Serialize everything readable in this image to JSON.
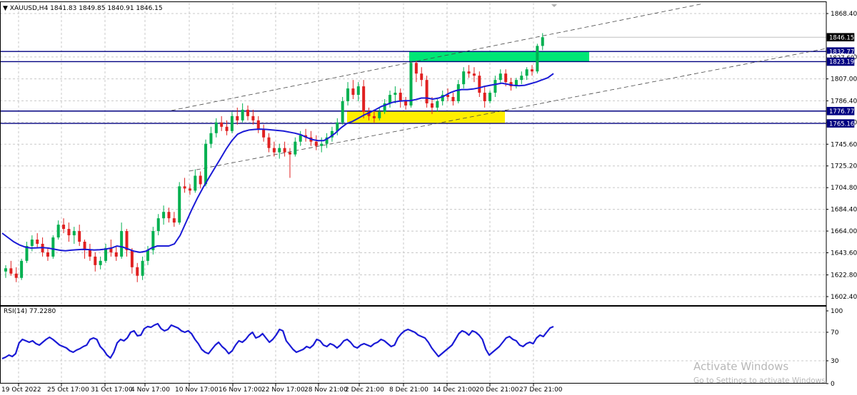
{
  "header": {
    "symbol": "XAUUSD,H4",
    "ohlc": "1841.83 1849.85 1840.91 1846.15",
    "menu_icon": "triangle-down-icon"
  },
  "rsi_header": {
    "label": "RSI(14) 77.2280"
  },
  "watermark": {
    "title": "Activate Windows",
    "subtitle": "Go to Settings to activate Windows."
  },
  "colors": {
    "bull_candle": "#00b050",
    "bear_candle": "#e02020",
    "ma_line": "#1a1ad6",
    "rsi_line": "#1a1ad6",
    "level_line": "#000080",
    "resistance_zone": "#00e676",
    "support_zone": "#ffee00",
    "grid": "#c8c8c8",
    "axis": "#000000"
  },
  "chart_data": [
    {
      "type": "candlestick",
      "symbol": "XAUUSD",
      "timeframe": "H4",
      "ylim": [
        1590.0,
        1880.0
      ],
      "y_ticks": [
        "1868.40",
        "1827.60",
        "1807.00",
        "1786.40",
        "1766.20",
        "1745.60",
        "1725.20",
        "1704.80",
        "1684.40",
        "1664.00",
        "1643.60",
        "1622.80",
        "1602.40"
      ],
      "x_ticks": [
        "19 Oct 2022",
        "25 Oct 17:00",
        "31 Oct 17:00",
        "4 Nov 17:00",
        "10 Nov 17:00",
        "16 Nov 17:00",
        "22 Nov 17:00",
        "28 Nov 21:00",
        "2 Dec 21:00",
        "8 Dec 21:00",
        "14 Dec 21:00",
        "20 Dec 21:00",
        "27 Dec 21:00"
      ],
      "price_labels": [
        {
          "text": "1846.15",
          "value": 1846.15,
          "style": "current"
        },
        {
          "text": "1832.77",
          "value": 1832.77,
          "style": "level"
        },
        {
          "text": "1827.60",
          "value": 1827.6,
          "style": "tick"
        },
        {
          "text": "1823.19",
          "value": 1823.19,
          "style": "level"
        },
        {
          "text": "1776.77",
          "value": 1776.77,
          "style": "level"
        },
        {
          "text": "1765.16",
          "value": 1765.16,
          "style": "level"
        }
      ],
      "horizontal_levels": [
        1832.77,
        1823.19,
        1776.77,
        1765.16
      ],
      "current_price": 1846.15,
      "zones": [
        {
          "name": "resistance",
          "from_x": "6 Dec 21:00",
          "to_x": "31 Dec",
          "y_low": 1823.19,
          "y_high": 1832.77
        },
        {
          "name": "support",
          "from_x": "1 Dec 09:00",
          "to_x": "23 Dec 13:00",
          "y_low": 1765.16,
          "y_high": 1776.77
        }
      ],
      "channel_lines": [
        {
          "from": [
            "10 Nov 01:00",
            1776.2
          ],
          "to": [
            "5 Jan",
            1878.0
          ]
        },
        {
          "from": [
            "11 Nov 01:00",
            1722.2
          ],
          "to": [
            "5 Jan",
            1835.8
          ]
        }
      ],
      "series": [
        {
          "type": "ohlc",
          "points": [
            [
              1626,
              1632,
              1620,
              1629
            ],
            [
              1629,
              1636,
              1622,
              1624
            ],
            [
              1624,
              1630,
              1616,
              1620
            ],
            [
              1620,
              1638,
              1618,
              1636
            ],
            [
              1636,
              1654,
              1634,
              1650
            ],
            [
              1650,
              1660,
              1645,
              1656
            ],
            [
              1656,
              1662,
              1648,
              1652
            ],
            [
              1652,
              1658,
              1640,
              1644
            ],
            [
              1644,
              1648,
              1636,
              1640
            ],
            [
              1640,
              1660,
              1638,
              1658
            ],
            [
              1658,
              1674,
              1656,
              1670
            ],
            [
              1670,
              1676,
              1662,
              1666
            ],
            [
              1666,
              1672,
              1654,
              1660
            ],
            [
              1660,
              1668,
              1652,
              1664
            ],
            [
              1664,
              1670,
              1650,
              1654
            ],
            [
              1654,
              1656,
              1638,
              1646
            ],
            [
              1646,
              1652,
              1636,
              1640
            ],
            [
              1640,
              1644,
              1626,
              1632
            ],
            [
              1632,
              1640,
              1628,
              1636
            ],
            [
              1636,
              1652,
              1634,
              1648
            ],
            [
              1648,
              1656,
              1640,
              1644
            ],
            [
              1644,
              1650,
              1636,
              1640
            ],
            [
              1640,
              1672,
              1638,
              1664
            ],
            [
              1664,
              1666,
              1640,
              1646
            ],
            [
              1646,
              1648,
              1624,
              1630
            ],
            [
              1630,
              1634,
              1616,
              1622
            ],
            [
              1622,
              1640,
              1618,
              1636
            ],
            [
              1636,
              1650,
              1632,
              1646
            ],
            [
              1646,
              1668,
              1642,
              1664
            ],
            [
              1664,
              1680,
              1660,
              1676
            ],
            [
              1676,
              1688,
              1670,
              1682
            ],
            [
              1682,
              1686,
              1672,
              1676
            ],
            [
              1676,
              1682,
              1668,
              1672
            ],
            [
              1672,
              1710,
              1670,
              1706
            ],
            [
              1706,
              1714,
              1700,
              1704
            ],
            [
              1704,
              1708,
              1698,
              1702
            ],
            [
              1702,
              1722,
              1700,
              1716
            ],
            [
              1716,
              1720,
              1704,
              1708
            ],
            [
              1708,
              1750,
              1706,
              1746
            ],
            [
              1746,
              1762,
              1742,
              1756
            ],
            [
              1756,
              1770,
              1752,
              1766
            ],
            [
              1766,
              1772,
              1758,
              1762
            ],
            [
              1762,
              1768,
              1754,
              1758
            ],
            [
              1758,
              1776,
              1756,
              1772
            ],
            [
              1772,
              1780,
              1764,
              1768
            ],
            [
              1768,
              1784,
              1766,
              1778
            ],
            [
              1778,
              1782,
              1768,
              1772
            ],
            [
              1772,
              1778,
              1764,
              1768
            ],
            [
              1768,
              1772,
              1756,
              1760
            ],
            [
              1760,
              1764,
              1748,
              1752
            ],
            [
              1752,
              1756,
              1738,
              1742
            ],
            [
              1742,
              1748,
              1734,
              1738
            ],
            [
              1738,
              1746,
              1732,
              1742
            ],
            [
              1742,
              1748,
              1734,
              1738
            ],
            [
              1738,
              1742,
              1714,
              1736
            ],
            [
              1736,
              1752,
              1734,
              1748
            ],
            [
              1748,
              1758,
              1744,
              1754
            ],
            [
              1754,
              1760,
              1748,
              1752
            ],
            [
              1752,
              1758,
              1744,
              1748
            ],
            [
              1748,
              1754,
              1740,
              1744
            ],
            [
              1744,
              1752,
              1738,
              1746
            ],
            [
              1746,
              1756,
              1742,
              1752
            ],
            [
              1752,
              1762,
              1748,
              1758
            ],
            [
              1758,
              1770,
              1754,
              1766
            ],
            [
              1766,
              1790,
              1764,
              1786
            ],
            [
              1786,
              1804,
              1782,
              1798
            ],
            [
              1798,
              1806,
              1788,
              1792
            ],
            [
              1792,
              1804,
              1786,
              1800
            ],
            [
              1800,
              1806,
              1770,
              1776
            ],
            [
              1776,
              1780,
              1768,
              1772
            ],
            [
              1772,
              1778,
              1766,
              1770
            ],
            [
              1770,
              1780,
              1768,
              1776
            ],
            [
              1776,
              1788,
              1774,
              1784
            ],
            [
              1784,
              1796,
              1780,
              1792
            ],
            [
              1792,
              1800,
              1784,
              1794
            ],
            [
              1794,
              1798,
              1780,
              1786
            ],
            [
              1786,
              1790,
              1778,
              1782
            ],
            [
              1782,
              1824,
              1780,
              1822
            ],
            [
              1822,
              1824,
              1804,
              1812
            ],
            [
              1812,
              1818,
              1800,
              1806
            ],
            [
              1806,
              1810,
              1780,
              1784
            ],
            [
              1784,
              1790,
              1774,
              1780
            ],
            [
              1780,
              1788,
              1776,
              1786
            ],
            [
              1786,
              1796,
              1782,
              1792
            ],
            [
              1792,
              1798,
              1786,
              1790
            ],
            [
              1790,
              1794,
              1782,
              1786
            ],
            [
              1786,
              1806,
              1784,
              1802
            ],
            [
              1802,
              1818,
              1798,
              1814
            ],
            [
              1814,
              1820,
              1808,
              1812
            ],
            [
              1812,
              1818,
              1804,
              1810
            ],
            [
              1810,
              1814,
              1790,
              1794
            ],
            [
              1794,
              1800,
              1780,
              1786
            ],
            [
              1786,
              1796,
              1784,
              1794
            ],
            [
              1794,
              1810,
              1790,
              1806
            ],
            [
              1806,
              1816,
              1802,
              1812
            ],
            [
              1812,
              1816,
              1800,
              1804
            ],
            [
              1804,
              1808,
              1796,
              1800
            ],
            [
              1800,
              1808,
              1798,
              1806
            ],
            [
              1806,
              1814,
              1802,
              1810
            ],
            [
              1810,
              1818,
              1806,
              1816
            ],
            [
              1816,
              1820,
              1810,
              1814
            ],
            [
              1814,
              1840,
              1812,
              1838
            ],
            [
              1838,
              1850,
              1834,
              1846.15
            ]
          ]
        },
        {
          "type": "line",
          "role": "moving-average",
          "values": [
            1662.0,
            1658.0,
            1654.0,
            1651.0,
            1649.0,
            1648.0,
            1648.2,
            1648.4,
            1648.0,
            1647.0,
            1646.0,
            1645.5,
            1646.0,
            1646.4,
            1646.8,
            1646.6,
            1646.2,
            1646.4,
            1647.0,
            1648.0,
            1650.0,
            1649.0,
            1647.0,
            1645.0,
            1644.0,
            1645.0,
            1648.0,
            1650.0,
            1650.0,
            1650.0,
            1652.0,
            1660.0,
            1672.0,
            1684.0,
            1695.0,
            1705.0,
            1714.0,
            1723.0,
            1732.0,
            1741.0,
            1749.0,
            1755.0,
            1757.5,
            1759.0,
            1759.5,
            1759.8,
            1759.5,
            1759.0,
            1758.5,
            1758.0,
            1757.0,
            1756.0,
            1754.5,
            1752.0,
            1750.0,
            1749.0,
            1749.0,
            1752.0,
            1756.0,
            1761.0,
            1765.0,
            1767.0,
            1770.0,
            1773.0,
            1775.5,
            1778.0,
            1781.0,
            1783.0,
            1785.0,
            1786.0,
            1786.5,
            1786.5,
            1787.5,
            1789.0,
            1789.0,
            1788.0,
            1789.0,
            1791.0,
            1794.0,
            1796.0,
            1797.0,
            1797.0,
            1797.5,
            1798.5,
            1800.0,
            1801.0,
            1802.0,
            1803.0,
            1802.0,
            1801.0,
            1800.5,
            1801.0,
            1802.5,
            1804.0,
            1806.0,
            1808.0,
            1812.0
          ]
        }
      ]
    },
    {
      "type": "line",
      "indicator": "RSI(14)",
      "ylim": [
        20,
        100
      ],
      "y_ticks": [
        "100",
        "70",
        "30",
        "0"
      ],
      "series": [
        {
          "name": "RSI(14)",
          "values": [
            33,
            35,
            38,
            36,
            40,
            55,
            60,
            58,
            56,
            58,
            54,
            52,
            56,
            60,
            63,
            60,
            56,
            52,
            50,
            48,
            44,
            42,
            45,
            47,
            50,
            52,
            60,
            62,
            60,
            50,
            45,
            38,
            34,
            42,
            55,
            60,
            58,
            62,
            70,
            72,
            65,
            66,
            75,
            78,
            77,
            80,
            82,
            75,
            72,
            74,
            80,
            78,
            76,
            72,
            70,
            72,
            68,
            60,
            54,
            46,
            42,
            40,
            46,
            52,
            56,
            50,
            46,
            40,
            44,
            52,
            58,
            56,
            60,
            66,
            70,
            62,
            64,
            68,
            62,
            56,
            60,
            66,
            74,
            72,
            58,
            52,
            46,
            42,
            44,
            46,
            50,
            48,
            52,
            60,
            58,
            52,
            50,
            54,
            52,
            48,
            52,
            58,
            60,
            56,
            50,
            48,
            52,
            54,
            52,
            50,
            54,
            56,
            60,
            58,
            54,
            50,
            52,
            62,
            68,
            72,
            74,
            72,
            70,
            66,
            64,
            62,
            56,
            48,
            42,
            36,
            40,
            44,
            48,
            52,
            60,
            68,
            72,
            70,
            66,
            72,
            70,
            66,
            60,
            46,
            38,
            42,
            46,
            50,
            56,
            62,
            64,
            60,
            58,
            52,
            50,
            54,
            56,
            54,
            62,
            66,
            64,
            70,
            76,
            78
          ]
        }
      ]
    }
  ]
}
